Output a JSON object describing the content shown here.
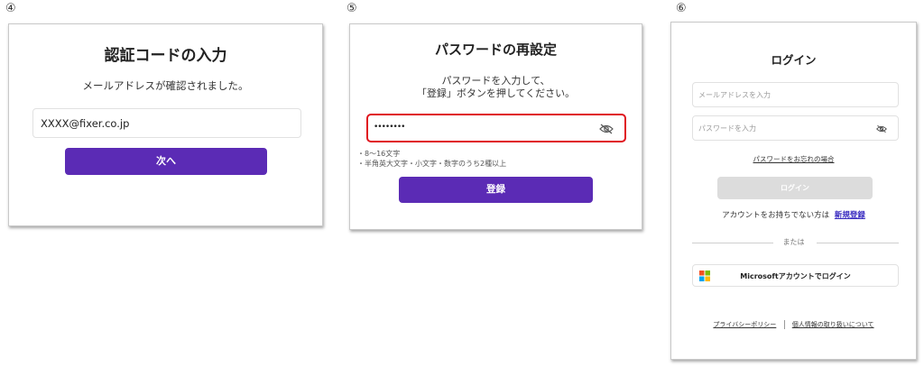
{
  "steps": [
    "④",
    "⑤",
    "⑥"
  ],
  "panel4": {
    "title": "認証コードの入力",
    "message": "メールアドレスが確認されました。",
    "code_value": "XXXX@fixer.co.jp",
    "next_button": "次へ"
  },
  "panel5": {
    "title": "パスワードの再設定",
    "instruction_line1": "パスワードを入力して、",
    "instruction_line2": "「登録」ボタンを押してください。",
    "password_value": "••••••••",
    "rule1": "・8～16文字",
    "rule2": "・半角英大文字・小文字・数字のうち2種以上",
    "register_button": "登録"
  },
  "panel6": {
    "title": "ログイン",
    "email_placeholder": "メールアドレスを入力",
    "password_placeholder": "パスワードを入力",
    "forgot_link": "パスワードをお忘れの場合",
    "login_button": "ログイン",
    "no_account_text": "アカウントをお持ちでない方は",
    "signup_link": "新規登録",
    "or_divider": "または",
    "microsoft_button": "Microsoftアカウントでログイン",
    "privacy_link": "プライバシーポリシー",
    "personal_info_link": "個人情報の取り扱いについて"
  },
  "colors": {
    "accent": "#5b2bb5",
    "highlight_border": "#e0141e",
    "disabled_button": "#dcdcdc",
    "signup_link": "#3a2cc0"
  }
}
